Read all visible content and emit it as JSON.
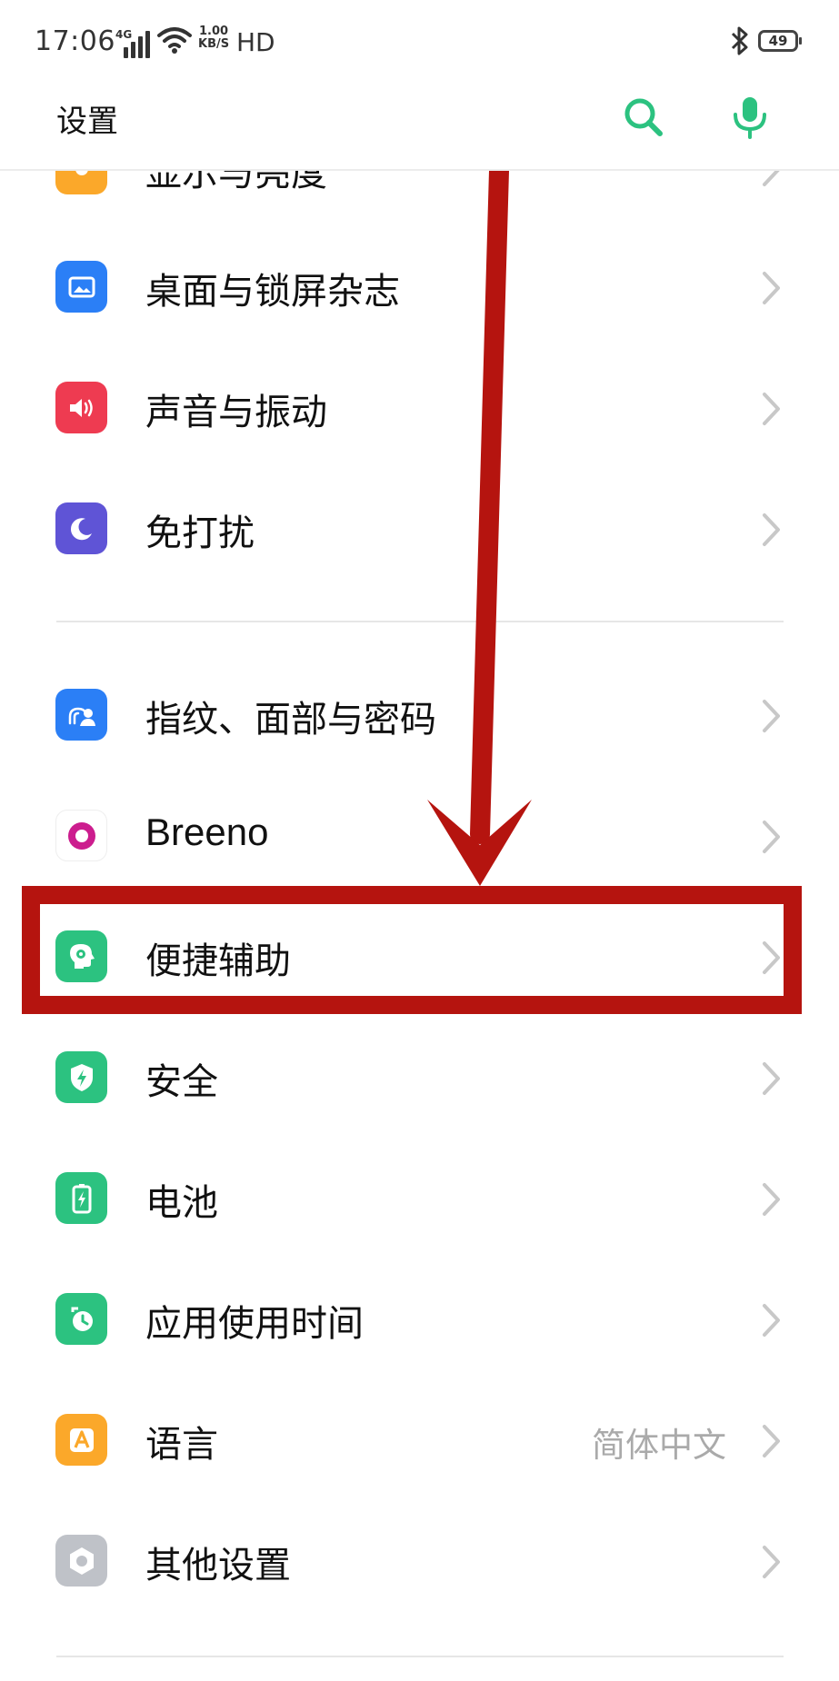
{
  "status_bar": {
    "time": "17:06",
    "network": "4G",
    "speed_value": "1.00",
    "speed_unit": "KB/S",
    "hd": "HD",
    "battery": "49",
    "icons": [
      "signal-icon",
      "wifi-icon",
      "bluetooth-icon",
      "battery-icon"
    ]
  },
  "header": {
    "title": "设置",
    "search_icon": "search-icon",
    "mic_icon": "mic-icon",
    "accent_color": "#2cc280"
  },
  "settings": {
    "partial_item": {
      "label": "显示与亮度",
      "icon": "sun-icon",
      "color": "#fba82a"
    },
    "items": [
      {
        "label": "桌面与锁屏杂志",
        "icon": "wallpaper-icon",
        "color": "#2b7ff6"
      },
      {
        "label": "声音与振动",
        "icon": "speaker-icon",
        "color": "#ee3b51"
      },
      {
        "label": "免打扰",
        "icon": "moon-icon",
        "color": "#5f54d6"
      },
      {
        "label": "指纹、面部与密码",
        "icon": "fingerprint-user-icon",
        "color": "#2b7ff6"
      },
      {
        "label": "Breeno",
        "icon": "breeno-icon",
        "color": "#ffffff"
      },
      {
        "label": "便捷辅助",
        "icon": "assist-head-icon",
        "color": "#2cc280"
      },
      {
        "label": "安全",
        "icon": "shield-icon",
        "color": "#2cc280"
      },
      {
        "label": "电池",
        "icon": "battery-charge-icon",
        "color": "#2cc280"
      },
      {
        "label": "应用使用时间",
        "icon": "app-time-icon",
        "color": "#2cc280"
      },
      {
        "label": "语言",
        "value": "简体中文",
        "icon": "language-icon",
        "color": "#fba82a"
      },
      {
        "label": "其他设置",
        "icon": "hexagon-icon",
        "color": "#bfc2c8"
      }
    ]
  },
  "annotation": {
    "color": "#b5140f",
    "target": "便捷辅助"
  }
}
